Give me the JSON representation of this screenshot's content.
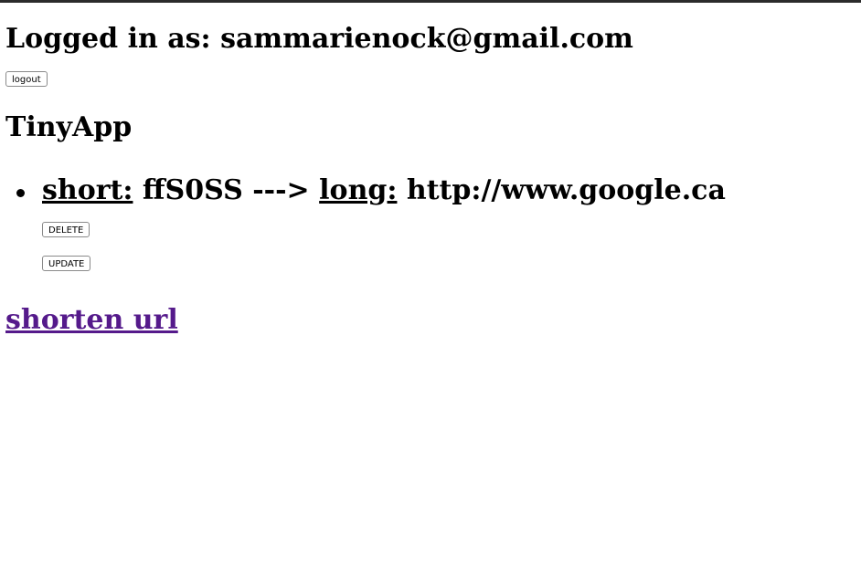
{
  "header": {
    "login_prefix": "Logged in as:",
    "user_email": "sammarienock@gmail.com",
    "logout_label": "logout"
  },
  "app": {
    "title": "TinyApp"
  },
  "urls": [
    {
      "short_label": "short:",
      "short_id": "ffS0SS",
      "arrow": "--->",
      "long_label": "long:",
      "long_url": "http://www.google.ca",
      "delete_label": "DELETE",
      "update_label": "UPDATE"
    }
  ],
  "links": {
    "shorten_label": "shorten url",
    "visited_color": "#551a8b"
  }
}
